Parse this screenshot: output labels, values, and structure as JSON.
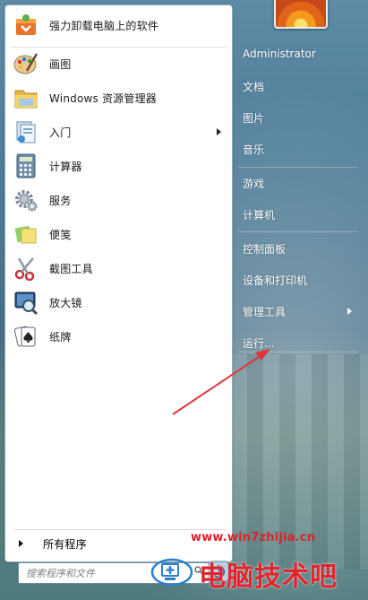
{
  "pinned": {
    "label": "强力卸载电脑上的软件"
  },
  "recent": [
    {
      "label": "画图",
      "icon": "paint-icon",
      "submenu": false
    },
    {
      "label": "Windows 资源管理器",
      "icon": "explorer-folder-icon",
      "submenu": false
    },
    {
      "label": "入门",
      "icon": "getting-started-icon",
      "submenu": true
    },
    {
      "label": "计算器",
      "icon": "calculator-icon",
      "submenu": false
    },
    {
      "label": "服务",
      "icon": "services-gear-icon",
      "submenu": false
    },
    {
      "label": "便笺",
      "icon": "sticky-notes-icon",
      "submenu": false
    },
    {
      "label": "截图工具",
      "icon": "snipping-tool-icon",
      "submenu": false
    },
    {
      "label": "放大镜",
      "icon": "magnifier-icon",
      "submenu": false
    },
    {
      "label": "纸牌",
      "icon": "solitaire-icon",
      "submenu": false
    }
  ],
  "all_programs": "所有程序",
  "search": {
    "placeholder": "搜索程序和文件"
  },
  "right_menu": [
    {
      "label": "Administrator",
      "submenu": false
    },
    {
      "label": "文档",
      "submenu": false
    },
    {
      "label": "图片",
      "submenu": false
    },
    {
      "label": "音乐",
      "submenu": false
    },
    {
      "label": "游戏",
      "submenu": false
    },
    {
      "label": "计算机",
      "submenu": false
    },
    {
      "label": "控制面板",
      "submenu": false
    },
    {
      "label": "设备和打印机",
      "submenu": false
    },
    {
      "label": "管理工具",
      "submenu": true
    },
    {
      "label": "运行...",
      "submenu": false
    }
  ],
  "watermark": {
    "url": "www.win7zhijia.cn",
    "brand": "电脑技术吧"
  },
  "colors": {
    "annotation_arrow": "#e0353a",
    "watermark": "#e0202a"
  }
}
